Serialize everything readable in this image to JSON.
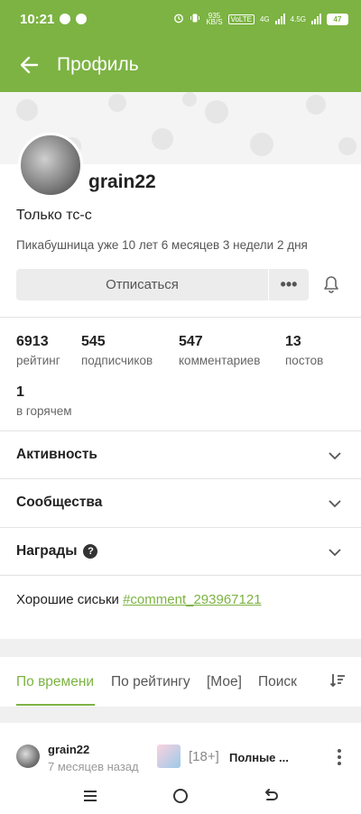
{
  "status_bar": {
    "time": "10:21",
    "net_speed": "935\nKB/S",
    "volte": "VoLTE",
    "sig1": "4G",
    "sig2": "4.5G",
    "battery": "47"
  },
  "app_bar": {
    "title": "Профиль"
  },
  "profile": {
    "username": "grain22",
    "bio": "Только тс-с",
    "tenure": "Пикабушница уже 10 лет 6 месяцев 3 недели 2 дня",
    "unsubscribe_label": "Отписаться",
    "more_label": "•••"
  },
  "stats": [
    {
      "value": "6913",
      "label": "рейтинг"
    },
    {
      "value": "545",
      "label": "подписчиков"
    },
    {
      "value": "547",
      "label": "комментариев"
    },
    {
      "value": "13",
      "label": "постов"
    },
    {
      "value": "1",
      "label": "в горячем"
    }
  ],
  "sections": [
    {
      "label": "Активность"
    },
    {
      "label": "Сообщества"
    },
    {
      "label": "Награды"
    }
  ],
  "note": {
    "text": "Хорошие сиськи ",
    "link": "#comment_293967121"
  },
  "tabs": [
    {
      "label": "По времени",
      "active": true
    },
    {
      "label": "По рейтингу"
    },
    {
      "label": "[Мое]"
    },
    {
      "label": "Поиск"
    }
  ],
  "post": {
    "user": "grain22",
    "time": "7 месяцев назад",
    "tag": "[18+]",
    "title": "Полные ..."
  },
  "colors": {
    "accent": "#7cb342"
  }
}
